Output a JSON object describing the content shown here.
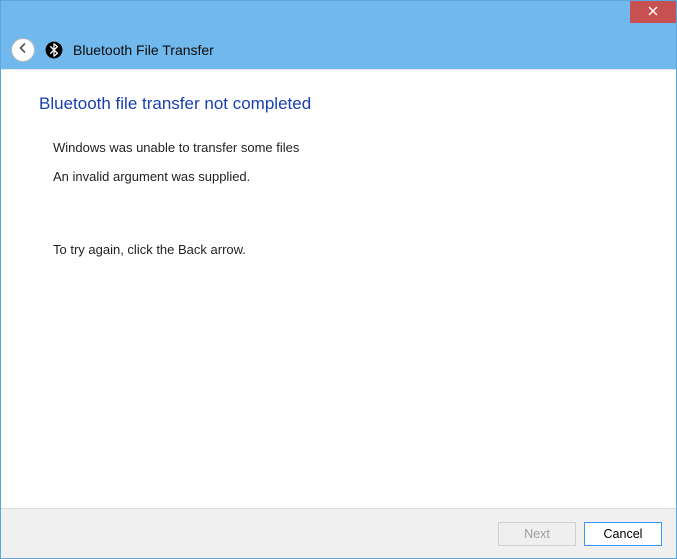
{
  "window": {
    "title": "Bluetooth File Transfer"
  },
  "content": {
    "heading": "Bluetooth file transfer not completed",
    "message1": "Windows was unable to transfer some files",
    "message2": "An invalid argument was supplied.",
    "instruction": "To try again, click the Back arrow."
  },
  "buttons": {
    "next": "Next",
    "cancel": "Cancel"
  },
  "colors": {
    "titlebar": "#71b8ec",
    "close": "#c75050",
    "heading": "#1a3fb0"
  }
}
